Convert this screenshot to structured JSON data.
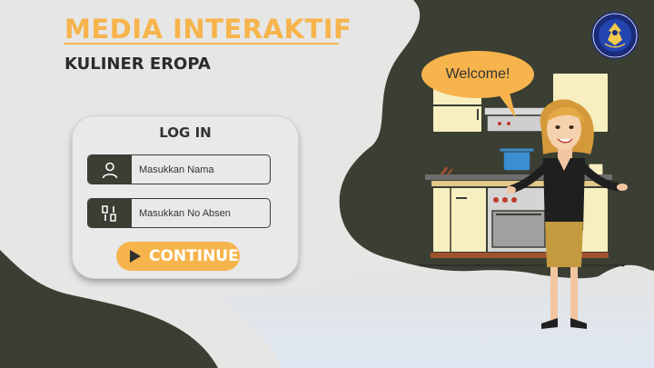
{
  "header": {
    "title": "MEDIA INTERAKTIF",
    "subtitle": "KULINER EROPA"
  },
  "login": {
    "title": "LOG IN",
    "name_field": {
      "placeholder": "Masukkan Nama",
      "value": "",
      "icon": "user-icon"
    },
    "absen_field": {
      "placeholder": "Masukkan No Absen",
      "value": "",
      "icon": "number-icon"
    },
    "continue_label": "CONTINUE",
    "continue_icon": "play-icon"
  },
  "welcome": {
    "text": "Welcome!"
  },
  "colors": {
    "accent": "#f7b44c",
    "dark": "#3b3e33",
    "background": "#e6e6e4"
  }
}
